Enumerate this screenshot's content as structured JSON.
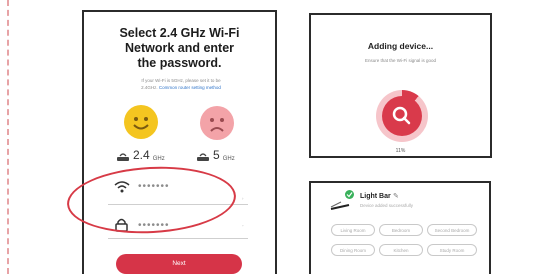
{
  "wifi_setup": {
    "title_line1": "Select 2.4 GHz Wi-Fi",
    "title_line2": "Network and enter",
    "title_line3": "the password.",
    "hint_line1": "If your Wi-Fi is 5GHz, please set it to be",
    "hint_line2_a": "2.4GHz.",
    "hint_line2_b": "Common router setting method",
    "band_good": {
      "value": "2.4",
      "unit": "GHz",
      "icon": "router-icon"
    },
    "band_bad": {
      "value": "5",
      "unit": "GHz",
      "icon": "router-icon"
    },
    "wifi_field_value": "•••••••",
    "password_field_value": "•••••••",
    "next_label": "Next",
    "highlight_color": "#d73a46",
    "accent_color": "#d63448"
  },
  "adding_device": {
    "title": "Adding device...",
    "subtitle": "Ensure that the Wi-Fi signal is good",
    "progress_label": "11%",
    "progress": 0.11,
    "icon": "search-icon"
  },
  "device_card": {
    "name": "Light Bar",
    "subtitle": "Device added successfully",
    "status_icon": "check-icon",
    "edit_icon": "pencil-icon",
    "rooms": [
      "Living Room",
      "Bedroom",
      "Second Bedroom",
      "Dining Room",
      "Kitchen",
      "Study Room"
    ]
  }
}
